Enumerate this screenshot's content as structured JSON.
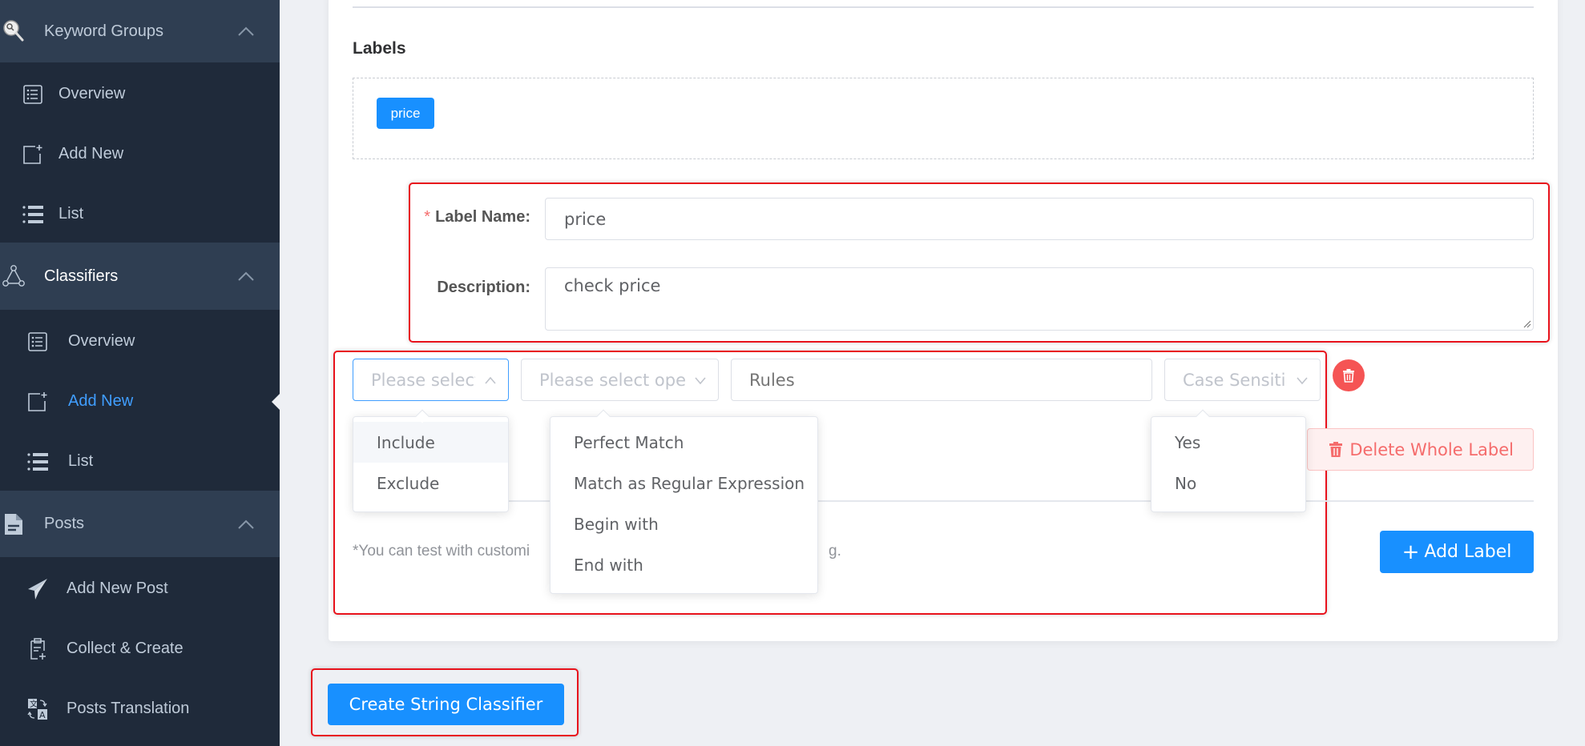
{
  "sidebar": {
    "groups": [
      {
        "label": "Keyword Groups",
        "icon": "key-search-icon",
        "items": [
          {
            "label": "Overview",
            "icon": "list-box-icon"
          },
          {
            "label": "Add New",
            "icon": "add-doc-icon"
          },
          {
            "label": "List",
            "icon": "list-icon"
          }
        ]
      },
      {
        "label": "Classifiers",
        "icon": "network-icon",
        "items": [
          {
            "label": "Overview",
            "icon": "list-box-icon"
          },
          {
            "label": "Add New",
            "icon": "add-doc-icon",
            "active": true
          },
          {
            "label": "List",
            "icon": "list-icon"
          }
        ]
      },
      {
        "label": "Posts",
        "icon": "document-icon",
        "items": [
          {
            "label": "Add New Post",
            "icon": "paper-plane-icon"
          },
          {
            "label": "Collect & Create",
            "icon": "clipboard-add-icon"
          },
          {
            "label": "Posts Translation",
            "icon": "translate-icon"
          }
        ]
      }
    ],
    "active_color": "#409eff"
  },
  "labels_section": {
    "title": "Labels",
    "tags": [
      "price"
    ]
  },
  "label_form": {
    "name_label": "Label Name:",
    "required_mark": "*",
    "name_value": "price",
    "description_label": "Description:",
    "description_value": "check price"
  },
  "rule_row": {
    "type_select": {
      "placeholder": "Please select",
      "open": true,
      "options": [
        "Include",
        "Exclude"
      ],
      "hovered": "Include"
    },
    "operator_select": {
      "placeholder": "Please select operator",
      "open": true,
      "options": [
        "Perfect Match",
        "Match as Regular Expression",
        "Begin with",
        "End with"
      ]
    },
    "rules_input": {
      "placeholder": "Rules",
      "value": ""
    },
    "case_select": {
      "placeholder": "Case Sensitive",
      "open": true,
      "options": [
        "Yes",
        "No"
      ]
    }
  },
  "buttons": {
    "delete_whole_label": "Delete Whole Label",
    "add_label": "Add Label",
    "create": "Create String Classifier"
  },
  "hint_text": "*You can test with customized text and check the result of the tag.",
  "hint_visible_left": "*You can test with customi",
  "hint_visible_right": "g.",
  "colors": {
    "primary": "#1890ff",
    "danger": "#f56c6c",
    "sidebar_bg": "#1f2a3a",
    "sidebar_header_bg": "#2f3e52",
    "highlight_border": "#e8121c"
  }
}
